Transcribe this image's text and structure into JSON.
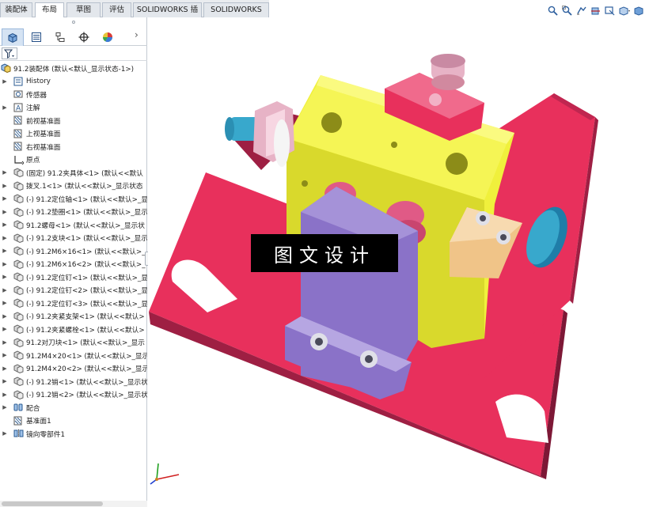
{
  "tabs": [
    {
      "label": "装配体",
      "active": false
    },
    {
      "label": "布局",
      "active": true
    },
    {
      "label": "草图",
      "active": false
    },
    {
      "label": "评估",
      "active": false
    },
    {
      "label": "SOLIDWORKS 插件",
      "active": false
    },
    {
      "label": "SOLIDWORKS MBD",
      "active": false
    }
  ],
  "view_tools": [
    "zoom-to-fit-icon",
    "zoom-to-area-icon",
    "previous-view-icon",
    "section-view-icon",
    "dynamic-annotation-icon",
    "view-orientation-icon",
    "display-style-icon"
  ],
  "panel_tabs": [
    "feature-manager-icon",
    "property-manager-icon",
    "configuration-manager-icon",
    "dimxpert-icon",
    "display-manager-icon"
  ],
  "panel_more": "›",
  "tree": {
    "root": "91.2装配体  (默认<默认_显示状态-1>)",
    "items": [
      {
        "label": "History",
        "expand": true,
        "icon": "history-icon"
      },
      {
        "label": "传感器",
        "expand": false,
        "icon": "sensor-icon"
      },
      {
        "label": "注解",
        "expand": true,
        "icon": "annotation-icon"
      },
      {
        "label": "前视基准面",
        "expand": false,
        "icon": "plane-icon"
      },
      {
        "label": "上视基准面",
        "expand": false,
        "icon": "plane-icon"
      },
      {
        "label": "右视基准面",
        "expand": false,
        "icon": "plane-icon"
      },
      {
        "label": "原点",
        "expand": false,
        "icon": "origin-icon"
      },
      {
        "label": "(固定) 91.2夹具体<1> (默认<<默认",
        "expand": true,
        "icon": "part-icon"
      },
      {
        "label": "拨叉.1<1> (默认<<默认>_显示状态",
        "expand": true,
        "icon": "part-icon"
      },
      {
        "label": "(-) 91.2定位轴<1> (默认<<默认>_显",
        "expand": true,
        "icon": "part-icon"
      },
      {
        "label": "(-) 91.2垫圈<1> (默认<<默认>_显示",
        "expand": true,
        "icon": "part-icon"
      },
      {
        "label": "91.2螺母<1> (默认<<默认>_显示状",
        "expand": true,
        "icon": "part-icon"
      },
      {
        "label": "(-) 91.2支块<1> (默认<<默认>_显示",
        "expand": true,
        "icon": "part-icon"
      },
      {
        "label": "(-) 91.2M6×16<1> (默认<<默认>_",
        "expand": true,
        "icon": "part-icon"
      },
      {
        "label": "(-) 91.2M6×16<2> (默认<<默认>_",
        "expand": true,
        "icon": "part-icon"
      },
      {
        "label": "(-) 91.2定位钉<1> (默认<<默认>_显",
        "expand": true,
        "icon": "part-icon"
      },
      {
        "label": "(-) 91.2定位钉<2> (默认<<默认>_显",
        "expand": true,
        "icon": "part-icon"
      },
      {
        "label": "(-) 91.2定位钉<3> (默认<<默认>_显",
        "expand": true,
        "icon": "part-icon"
      },
      {
        "label": "(-) 91.2夹紧支架<1> (默认<<默认>",
        "expand": true,
        "icon": "part-icon"
      },
      {
        "label": "(-) 91.2夹紧螺栓<1> (默认<<默认>",
        "expand": true,
        "icon": "part-icon"
      },
      {
        "label": "91.2对刀块<1> (默认<<默认>_显示",
        "expand": true,
        "icon": "part-icon"
      },
      {
        "label": "91.2M4×20<1> (默认<<默认>_显示",
        "expand": true,
        "icon": "part-icon"
      },
      {
        "label": "91.2M4×20<2> (默认<<默认>_显示",
        "expand": true,
        "icon": "part-icon"
      },
      {
        "label": "(-) 91.2销<1> (默认<<默认>_显示状",
        "expand": true,
        "icon": "part-icon"
      },
      {
        "label": "(-) 91.2销<2> (默认<<默认>_显示状",
        "expand": true,
        "icon": "part-icon"
      },
      {
        "label": "配合",
        "expand": true,
        "icon": "mates-icon"
      },
      {
        "label": "基准面1",
        "expand": false,
        "icon": "plane-icon"
      },
      {
        "label": "镜向零部件1",
        "expand": true,
        "icon": "mirror-component-icon"
      }
    ]
  },
  "watermark": "图文设计",
  "colors": {
    "fixture_body": "#e8305c",
    "fixture_shadow": "#9e1f43",
    "workpiece": "#f0f03c",
    "clamp_bracket": "#8a72c8",
    "bolt_cyan": "#38a8cc",
    "tool_block": "#f0c488",
    "triad_x": "#d02020",
    "triad_y": "#20a020",
    "triad_z": "#2040d0"
  }
}
